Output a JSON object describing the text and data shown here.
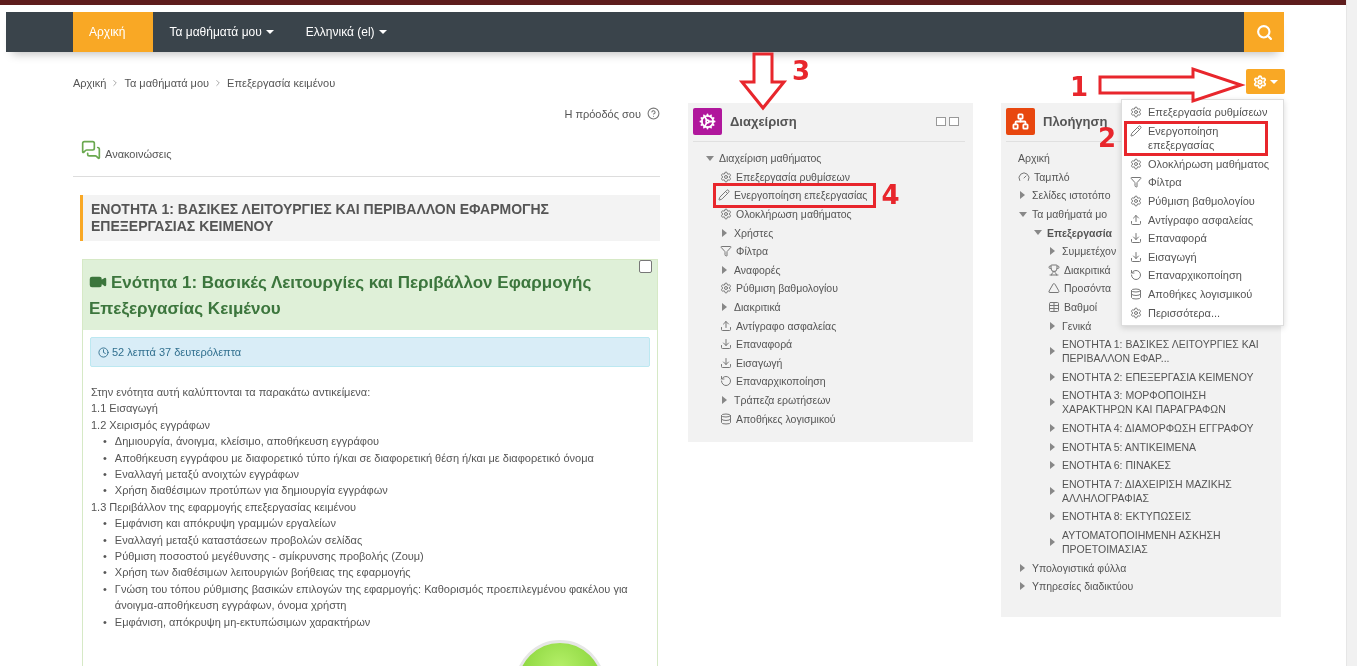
{
  "nav": {
    "items": [
      {
        "label": "Αρχική",
        "selected": true,
        "dropdown": false
      },
      {
        "label": "Τα μαθήματά μου",
        "selected": false,
        "dropdown": true
      },
      {
        "label": "Ελληνικά (el)",
        "selected": false,
        "dropdown": true
      }
    ]
  },
  "breadcrumb": [
    "Αρχική",
    "Τα μαθήματά μου",
    "Επεξεργασία κειμένου"
  ],
  "progress_label": "Η πρόοδός σου",
  "announcements": "Ανακοινώσεις",
  "section_heading": "ΕΝΟΤΗΤΑ 1: ΒΑΣΙΚΕΣ ΛΕΙΤΟΥΡΓΙΕΣ ΚΑΙ ΠΕΡΙΒΑΛΛΟΝ ΕΦΑΡΜΟΓΗΣ ΕΠΕΞΕΡΓΑΣΙΑΣ ΚΕΙΜΕΝΟΥ",
  "activity": {
    "title": "Ενότητα 1: Βασικές Λειτουργίες και Περιβάλλον Εφαρμογής Επεξεργασίας Κειμένου",
    "checked": false,
    "duration": "52 λεπτά 37 δευτερόλεπτα",
    "intro": "Στην ενότητα αυτή καλύπτονται τα παρακάτω αντικείμενα:",
    "outline": [
      {
        "kind": "heading",
        "text": "1.1 Εισαγωγή"
      },
      {
        "kind": "heading",
        "text": "1.2 Χειρισμός εγγράφων"
      },
      {
        "kind": "bullet",
        "marker": "•",
        "text": "Δημιουργία, άνοιγμα, κλείσιμο, αποθήκευση εγγράφου"
      },
      {
        "kind": "bullet",
        "marker": "•",
        "text": "Αποθήκευση εγγράφου με διαφορετικό τύπο ή/και σε διαφορετική θέση ή/και με διαφορετικό όνομα"
      },
      {
        "kind": "bullet",
        "marker": "•",
        "text": "Εναλλαγή μεταξύ ανοιχτών εγγράφων"
      },
      {
        "kind": "bullet",
        "marker": "•",
        "text": "Χρήση διαθέσιμων προτύπων για δημιουργία εγγράφων"
      },
      {
        "kind": "heading",
        "text": "1.3 Περιβάλλον της εφαρμογής επεξεργασίας κειμένου"
      },
      {
        "kind": "bullet",
        "marker": "•",
        "text": "Εμφάνιση και απόκρυψη γραμμών εργαλείων"
      },
      {
        "kind": "bullet",
        "marker": "•",
        "text": "Εναλλαγή μεταξύ καταστάσεων προβολών σελίδας"
      },
      {
        "kind": "bullet",
        "marker": "•",
        "text": "Ρύθμιση ποσοστού μεγέθυνσης - σμίκρυνσης προβολής (Ζουμ)"
      },
      {
        "kind": "bullet",
        "marker": "•",
        "text": "Χρήση των διαθέσιμων λειτουργιών βοήθειας της εφαρμογής"
      },
      {
        "kind": "bullet",
        "marker": "•",
        "text": "Γνώση του τόπου ρύθμισης βασικών επιλογών της εφαρμογής: Καθορισμός προεπιλεγμένου φακέλου για άνοιγμα-αποθήκευση εγγράφων, όνομα χρήστη"
      },
      {
        "kind": "bullet",
        "marker": "•",
        "text": "Εμφάνιση, απόκρυψη μη-εκτυπώσιμων χαρακτήρων"
      }
    ]
  },
  "admin_block": {
    "title": "Διαχείριση",
    "items": [
      {
        "kind": "branch",
        "label": "Διαχείριση μαθήματος",
        "expanded": true,
        "children": [
          {
            "kind": "settings",
            "label": "Επεξεργασία ρυθμίσεων"
          },
          {
            "kind": "edit",
            "label": "Ενεργοποίηση επεξεργασίας",
            "highlighted": true,
            "annotation": "4"
          },
          {
            "kind": "settings",
            "label": "Ολοκλήρωση μαθήματος"
          },
          {
            "kind": "branch",
            "label": "Χρήστες",
            "expanded": false
          },
          {
            "kind": "filter",
            "label": "Φίλτρα"
          },
          {
            "kind": "branch",
            "label": "Αναφορές",
            "expanded": false
          },
          {
            "kind": "settings",
            "label": "Ρύθμιση βαθμολογίου"
          },
          {
            "kind": "branch",
            "label": "Διακριτικά",
            "expanded": false
          },
          {
            "kind": "backup",
            "label": "Αντίγραφο ασφαλείας"
          },
          {
            "kind": "restore",
            "label": "Επαναφορά"
          },
          {
            "kind": "restore",
            "label": "Εισαγωγή"
          },
          {
            "kind": "reset",
            "label": "Επαναρχικοποίηση"
          },
          {
            "kind": "branch",
            "label": "Τράπεζα ερωτήσεων",
            "expanded": false
          },
          {
            "kind": "repository",
            "label": "Αποθήκες λογισμικού"
          }
        ]
      }
    ]
  },
  "nav_block": {
    "title": "Πλοήγηση",
    "items": [
      {
        "kind": "link",
        "label": "Αρχική"
      },
      {
        "kind": "dashboard",
        "label": "Ταμπλό"
      },
      {
        "kind": "branch",
        "label": "Σελίδες ιστοτόπο",
        "expanded": false
      },
      {
        "kind": "branch",
        "label": "Τα μαθήματά μο",
        "expanded": true,
        "children": [
          {
            "kind": "branch",
            "label": "Επεξεργασία",
            "expanded": true,
            "current": true,
            "children": [
              {
                "kind": "branch",
                "label": "Συμμετέχον",
                "expanded": false
              },
              {
                "kind": "badges",
                "label": "Διακριτικά"
              },
              {
                "kind": "competencies",
                "label": "Προσόντα"
              },
              {
                "kind": "grades",
                "label": "Βαθμοί"
              },
              {
                "kind": "branch",
                "label": "Γενικά",
                "expanded": false
              },
              {
                "kind": "branch",
                "label": "ΕΝΟΤΗΤΑ 1: ΒΑΣΙΚΕΣ ΛΕΙΤΟΥΡΓΙΕΣ ΚΑΙ ΠΕΡΙΒΑΛΛΟΝ ΕΦΑΡ...",
                "expanded": false
              },
              {
                "kind": "branch",
                "label": "ΕΝΟΤΗΤΑ 2: ΕΠΕΞΕΡΓΑΣΙΑ ΚΕΙΜΕΝΟΥ",
                "expanded": false
              },
              {
                "kind": "branch",
                "label": "ΕΝΟΤΗΤΑ 3: ΜΟΡΦΟΠΟΙΗΣΗ ΧΑΡΑΚΤΗΡΩΝ ΚΑΙ ΠΑΡΑΓΡΑΦΩΝ",
                "expanded": false
              },
              {
                "kind": "branch",
                "label": "ΕΝΟΤΗΤΑ 4: ΔΙΑΜΟΡΦΩΣΗ ΕΓΓΡΑΦΟΥ",
                "expanded": false
              },
              {
                "kind": "branch",
                "label": "ΕΝΟΤΗΤΑ 5: ΑΝΤΙΚΕΙΜΕΝΑ",
                "expanded": false
              },
              {
                "kind": "branch",
                "label": "ΕΝΟΤΗΤΑ 6: ΠΙΝΑΚΕΣ",
                "expanded": false
              },
              {
                "kind": "branch",
                "label": "ΕΝΟΤΗΤΑ 7: ΔΙΑΧΕΙΡΙΣΗ ΜΑΖΙΚΗΣ ΑΛΛΗΛΟΓΡΑΦΙΑΣ",
                "expanded": false
              },
              {
                "kind": "branch",
                "label": "ΕΝΟΤΗΤΑ 8: ΕΚΤΥΠΩΣΕΙΣ",
                "expanded": false
              },
              {
                "kind": "branch",
                "label": "ΑΥΤΟΜΑΤΟΠΟΙΗΜΕΝΗ ΑΣΚΗΣΗ ΠΡΟΕΤΟΙΜΑΣΙΑΣ",
                "expanded": false
              }
            ]
          }
        ]
      },
      {
        "kind": "branch",
        "label": "Υπολογιστικά φύλλα",
        "expanded": false
      },
      {
        "kind": "branch",
        "label": "Υπηρεσίες διαδικτύου",
        "expanded": false
      }
    ]
  },
  "gear_menu": {
    "items": [
      {
        "kind": "settings",
        "label": "Επεξεργασία ρυθμίσεων"
      },
      {
        "kind": "edit",
        "label": "Ενεργοποίηση επεξεργασίας",
        "highlighted": true,
        "annotation": "2"
      },
      {
        "kind": "settings",
        "label": "Ολοκλήρωση μαθήματος"
      },
      {
        "kind": "filter",
        "label": "Φίλτρα"
      },
      {
        "kind": "settings",
        "label": "Ρύθμιση βαθμολογίου"
      },
      {
        "kind": "backup",
        "label": "Αντίγραφο ασφαλείας"
      },
      {
        "kind": "restore",
        "label": "Επαναφορά"
      },
      {
        "kind": "restore",
        "label": "Εισαγωγή"
      },
      {
        "kind": "reset",
        "label": "Επαναρχικοποίηση"
      },
      {
        "kind": "repository",
        "label": "Αποθήκες λογισμικού"
      },
      {
        "kind": "settings",
        "label": "Περισσότερα..."
      }
    ]
  },
  "annotations": [
    {
      "kind": "gear",
      "text": "1"
    },
    {
      "kind": "admin",
      "text": "3"
    }
  ]
}
